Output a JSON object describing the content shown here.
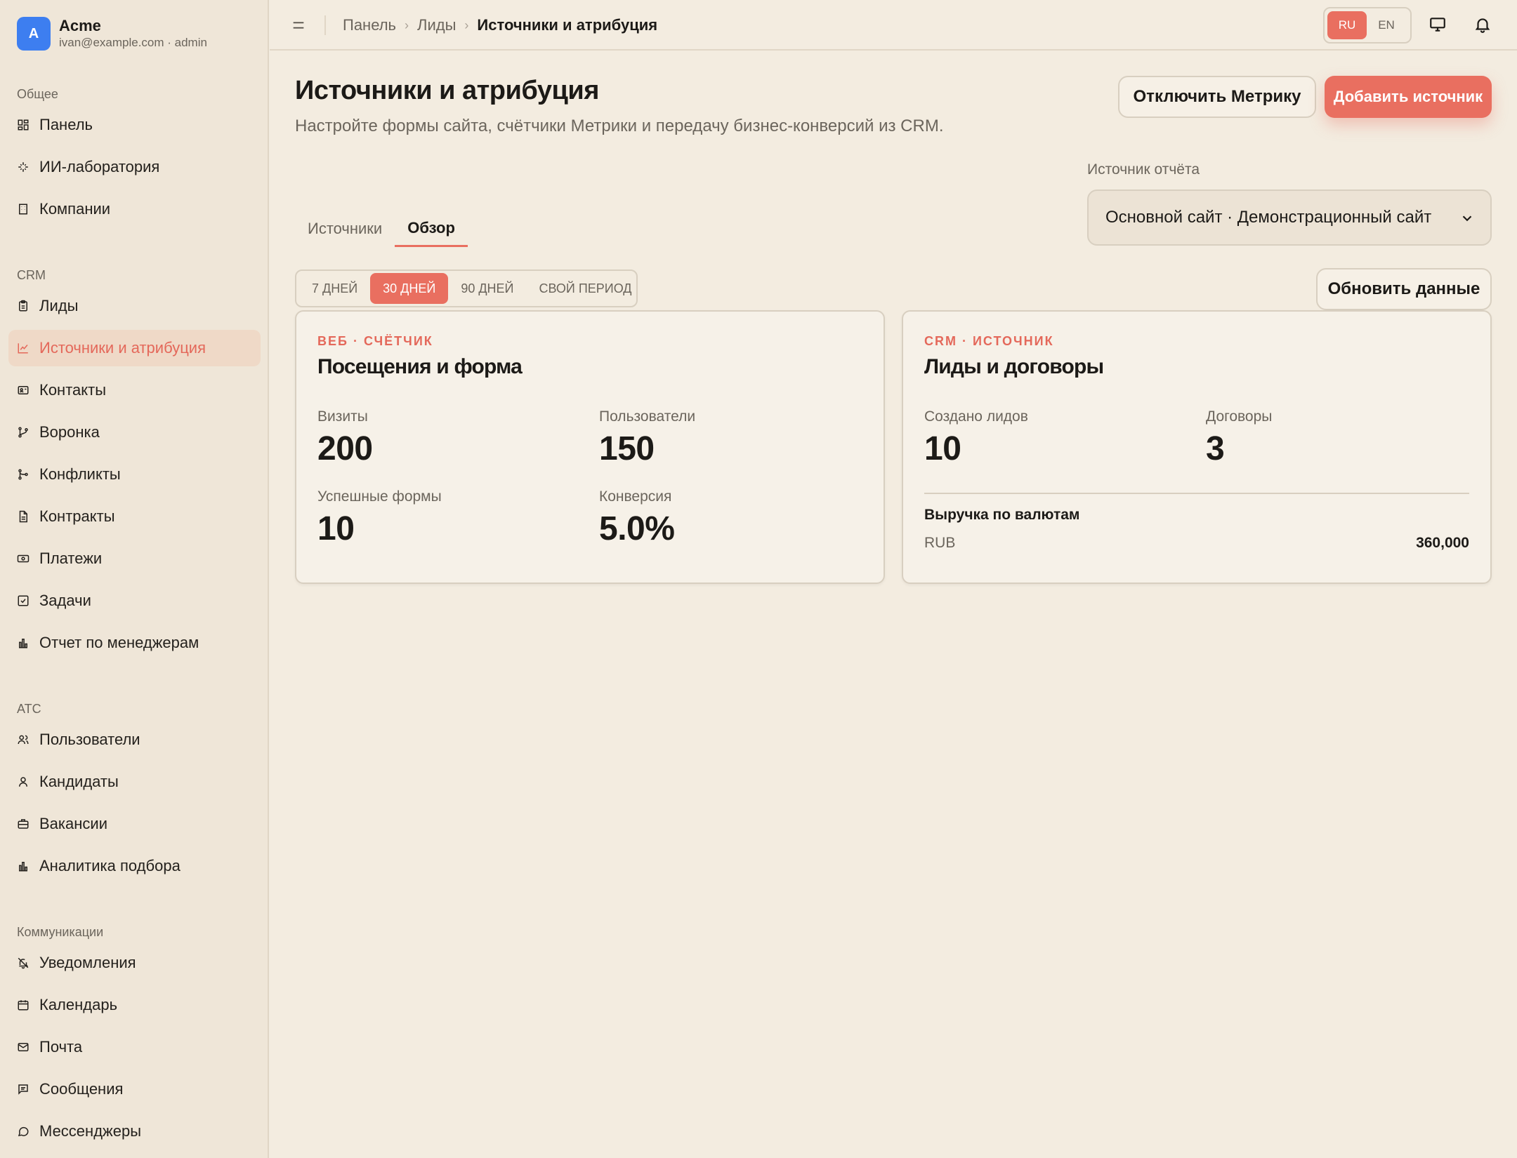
{
  "brand": {
    "avatar": "A",
    "name": "Acme",
    "sub": "ivan@example.com · admin"
  },
  "sidebar": {
    "sections": [
      {
        "heading": "Общее",
        "items": [
          {
            "label": "Панель",
            "icon": "dashboard-icon"
          },
          {
            "label": "ИИ-лаборатория",
            "icon": "sparkle-icon"
          },
          {
            "label": "Компании",
            "icon": "building-icon"
          }
        ]
      },
      {
        "heading": "CRM",
        "items": [
          {
            "label": "Лиды",
            "icon": "clipboard-icon"
          },
          {
            "label": "Источники и атрибуция",
            "icon": "chart-line-icon",
            "active": true
          },
          {
            "label": "Контакты",
            "icon": "contact-card-icon"
          },
          {
            "label": "Воронка",
            "icon": "git-branch-icon"
          },
          {
            "label": "Конфликты",
            "icon": "git-merge-icon"
          },
          {
            "label": "Контракты",
            "icon": "file-text-icon"
          },
          {
            "label": "Платежи",
            "icon": "banknote-icon"
          },
          {
            "label": "Задачи",
            "icon": "checkbox-icon"
          },
          {
            "label": "Отчет по менеджерам",
            "icon": "bar-chart-icon"
          }
        ]
      },
      {
        "heading": "ATC",
        "items": [
          {
            "label": "Пользователи",
            "icon": "users-icon"
          },
          {
            "label": "Кандидаты",
            "icon": "user-icon"
          },
          {
            "label": "Вакансии",
            "icon": "briefcase-icon"
          },
          {
            "label": "Аналитика подбора",
            "icon": "bar-chart-icon"
          }
        ]
      },
      {
        "heading": "Коммуникации",
        "items": [
          {
            "label": "Уведомления",
            "icon": "bell-off-icon"
          },
          {
            "label": "Календарь",
            "icon": "calendar-icon"
          },
          {
            "label": "Почта",
            "icon": "mail-icon"
          },
          {
            "label": "Сообщения",
            "icon": "message-square-icon"
          },
          {
            "label": "Мессенджеры",
            "icon": "message-circle-icon"
          }
        ]
      }
    ]
  },
  "topbar": {
    "breadcrumb": [
      "Панель",
      "Лиды",
      "Источники и атрибуция"
    ],
    "lang": [
      "RU",
      "EN"
    ],
    "lang_active": "RU"
  },
  "header": {
    "title": "Источники и атрибуция",
    "description": "Настройте формы сайта, счётчики Метрики и передачу бизнес-конверсий из CRM.",
    "disable_button": "Отключить Метрику",
    "add_button": "Добавить источник"
  },
  "tabs": [
    "Источники",
    "Обзор"
  ],
  "tab_active": "Обзор",
  "report_source": {
    "label": "Источник отчёта",
    "value": "Основной сайт · Демонстрационный сайт"
  },
  "periods": [
    "7 ДНЕЙ",
    "30 ДНЕЙ",
    "90 ДНЕЙ",
    "СВОЙ ПЕРИОД"
  ],
  "period_active": "30 ДНЕЙ",
  "refresh_button": "Обновить данные",
  "web_card": {
    "kicker": "ВЕБ · СЧЁТЧИК",
    "title": "Посещения и форма",
    "metrics": [
      {
        "label": "Визиты",
        "value": "200"
      },
      {
        "label": "Пользователи",
        "value": "150"
      },
      {
        "label": "Успешные формы",
        "value": "10"
      },
      {
        "label": "Конверсия",
        "value": "5.0%"
      }
    ]
  },
  "crm_card": {
    "kicker": "CRM · ИСТОЧНИК",
    "title": "Лиды и договоры",
    "metrics": [
      {
        "label": "Создано лидов",
        "value": "10"
      },
      {
        "label": "Договоры",
        "value": "3"
      }
    ],
    "revenue_title": "Выручка по валютам",
    "revenue": [
      {
        "currency": "RUB",
        "amount": "360,000"
      }
    ]
  },
  "colors": {
    "accent": "#e96f60",
    "background": "#f3ece0",
    "sidebar": "#efe6d8",
    "brand_avatar": "#3d7ef0"
  }
}
